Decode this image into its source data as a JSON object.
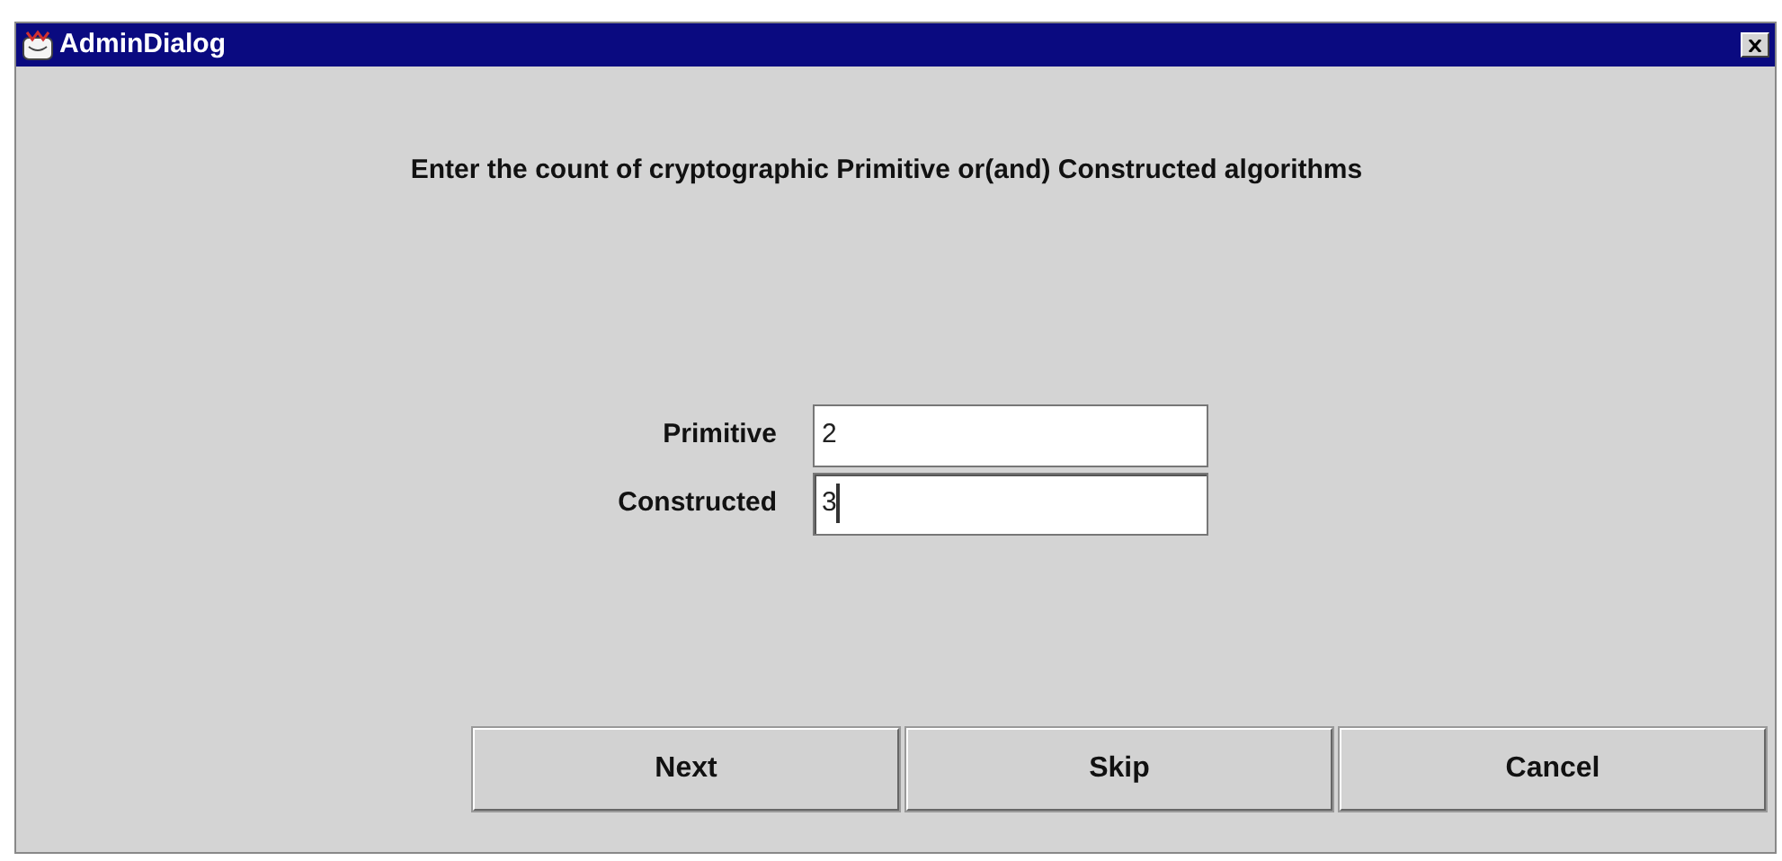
{
  "window": {
    "title": "AdminDialog"
  },
  "prompt": "Enter the count of cryptographic Primitive or(and) Constructed algorithms",
  "fields": [
    {
      "label": "Primitive",
      "value": "2",
      "focused": false
    },
    {
      "label": "Constructed",
      "value": "3",
      "focused": true
    }
  ],
  "buttons": [
    "Next",
    "Skip",
    "Cancel"
  ]
}
